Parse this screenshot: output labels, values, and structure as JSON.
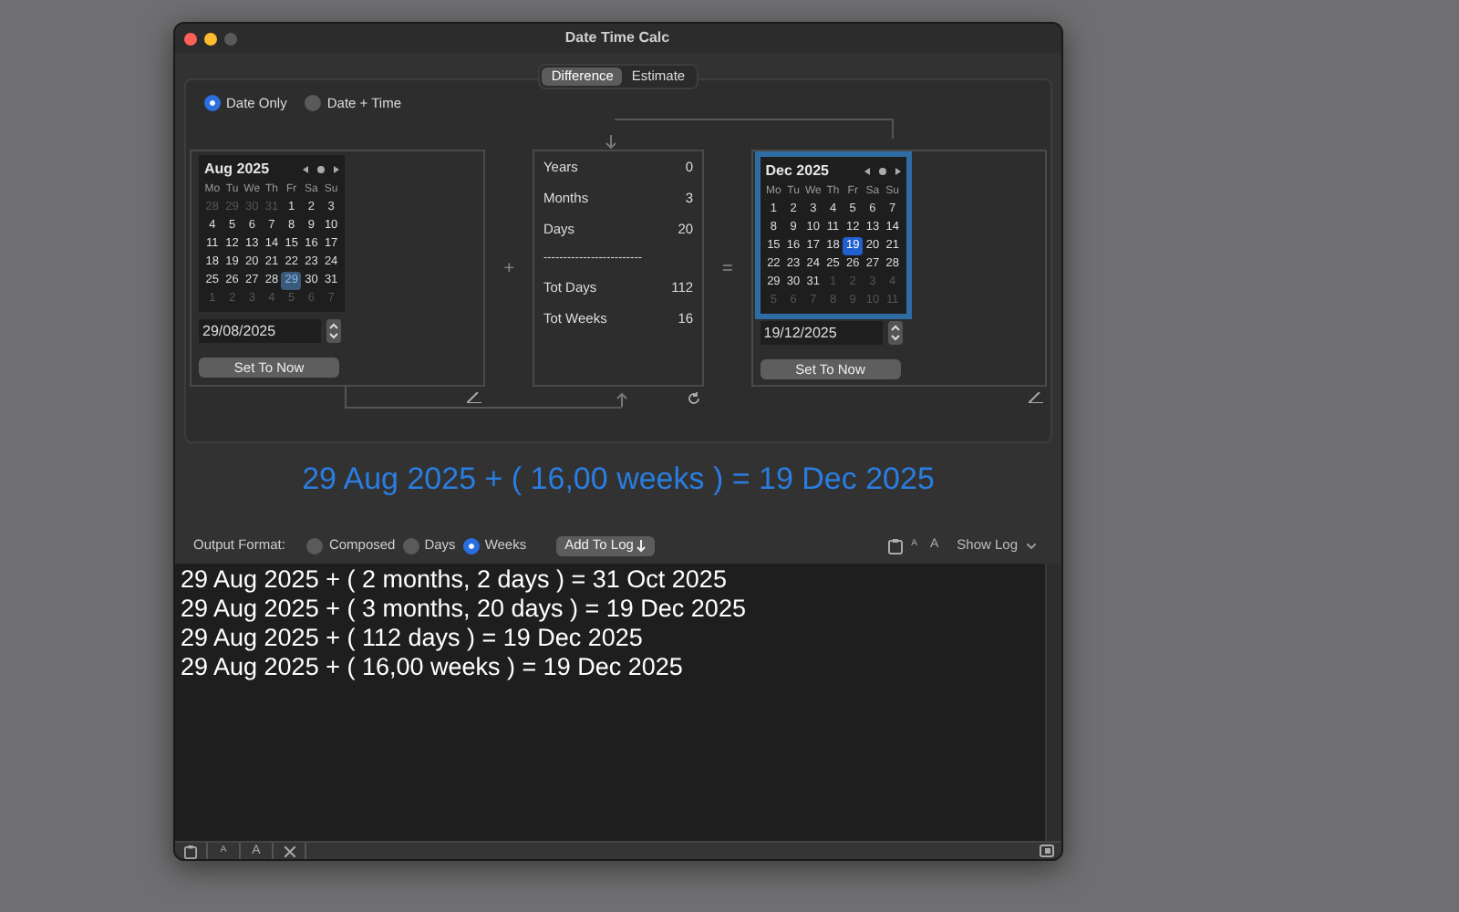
{
  "window": {
    "title": "Date Time Calc"
  },
  "tabs": [
    {
      "label": "Difference",
      "selected": true
    },
    {
      "label": "Estimate",
      "selected": false
    }
  ],
  "mode": [
    {
      "label": "Date Only",
      "selected": true
    },
    {
      "label": "Date + Time",
      "selected": false
    }
  ],
  "start": {
    "month": "Aug 2025",
    "weekdays": [
      "Mo",
      "Tu",
      "We",
      "Th",
      "Fr",
      "Sa",
      "Su"
    ],
    "focused": false,
    "weeks": [
      [
        {
          "d": "28",
          "muted": true,
          "selected": false
        },
        {
          "d": "29",
          "muted": true,
          "selected": false
        },
        {
          "d": "30",
          "muted": true,
          "selected": false
        },
        {
          "d": "31",
          "muted": true,
          "selected": false
        },
        {
          "d": "1",
          "muted": false,
          "selected": false
        },
        {
          "d": "2",
          "muted": false,
          "selected": false
        },
        {
          "d": "3",
          "muted": false,
          "selected": false
        }
      ],
      [
        {
          "d": "4",
          "muted": false,
          "selected": false
        },
        {
          "d": "5",
          "muted": false,
          "selected": false
        },
        {
          "d": "6",
          "muted": false,
          "selected": false
        },
        {
          "d": "7",
          "muted": false,
          "selected": false
        },
        {
          "d": "8",
          "muted": false,
          "selected": false
        },
        {
          "d": "9",
          "muted": false,
          "selected": false
        },
        {
          "d": "10",
          "muted": false,
          "selected": false
        }
      ],
      [
        {
          "d": "11",
          "muted": false,
          "selected": false
        },
        {
          "d": "12",
          "muted": false,
          "selected": false
        },
        {
          "d": "13",
          "muted": false,
          "selected": false
        },
        {
          "d": "14",
          "muted": false,
          "selected": false
        },
        {
          "d": "15",
          "muted": false,
          "selected": false
        },
        {
          "d": "16",
          "muted": false,
          "selected": false
        },
        {
          "d": "17",
          "muted": false,
          "selected": false
        }
      ],
      [
        {
          "d": "18",
          "muted": false,
          "selected": false
        },
        {
          "d": "19",
          "muted": false,
          "selected": false
        },
        {
          "d": "20",
          "muted": false,
          "selected": false
        },
        {
          "d": "21",
          "muted": false,
          "selected": false
        },
        {
          "d": "22",
          "muted": false,
          "selected": false
        },
        {
          "d": "23",
          "muted": false,
          "selected": false
        },
        {
          "d": "24",
          "muted": false,
          "selected": false
        }
      ],
      [
        {
          "d": "25",
          "muted": false,
          "selected": false
        },
        {
          "d": "26",
          "muted": false,
          "selected": false
        },
        {
          "d": "27",
          "muted": false,
          "selected": false
        },
        {
          "d": "28",
          "muted": false,
          "selected": false
        },
        {
          "d": "29",
          "muted": false,
          "selected": true
        },
        {
          "d": "30",
          "muted": false,
          "selected": false
        },
        {
          "d": "31",
          "muted": false,
          "selected": false
        }
      ],
      [
        {
          "d": "1",
          "muted": true,
          "selected": false
        },
        {
          "d": "2",
          "muted": true,
          "selected": false
        },
        {
          "d": "3",
          "muted": true,
          "selected": false
        },
        {
          "d": "4",
          "muted": true,
          "selected": false
        },
        {
          "d": "5",
          "muted": true,
          "selected": false
        },
        {
          "d": "6",
          "muted": true,
          "selected": false
        },
        {
          "d": "7",
          "muted": true,
          "selected": false
        }
      ]
    ],
    "date": "29/08/2025",
    "button": "Set To Now"
  },
  "operator_plus": "+",
  "difference": {
    "rows": [
      {
        "label": "Years",
        "value": "0"
      },
      {
        "label": "Months",
        "value": "3"
      },
      {
        "label": "Days",
        "value": "20"
      }
    ],
    "separator": "-------------------------",
    "totals": [
      {
        "label": "Tot Days",
        "value": "112"
      },
      {
        "label": "Tot Weeks",
        "value": "16"
      }
    ]
  },
  "operator_equals": "=",
  "end": {
    "month": "Dec 2025",
    "weekdays": [
      "Mo",
      "Tu",
      "We",
      "Th",
      "Fr",
      "Sa",
      "Su"
    ],
    "focused": true,
    "weeks": [
      [
        {
          "d": "1",
          "muted": false,
          "selected": false
        },
        {
          "d": "2",
          "muted": false,
          "selected": false
        },
        {
          "d": "3",
          "muted": false,
          "selected": false
        },
        {
          "d": "4",
          "muted": false,
          "selected": false
        },
        {
          "d": "5",
          "muted": false,
          "selected": false
        },
        {
          "d": "6",
          "muted": false,
          "selected": false
        },
        {
          "d": "7",
          "muted": false,
          "selected": false
        }
      ],
      [
        {
          "d": "8",
          "muted": false,
          "selected": false
        },
        {
          "d": "9",
          "muted": false,
          "selected": false
        },
        {
          "d": "10",
          "muted": false,
          "selected": false
        },
        {
          "d": "11",
          "muted": false,
          "selected": false
        },
        {
          "d": "12",
          "muted": false,
          "selected": false
        },
        {
          "d": "13",
          "muted": false,
          "selected": false
        },
        {
          "d": "14",
          "muted": false,
          "selected": false
        }
      ],
      [
        {
          "d": "15",
          "muted": false,
          "selected": false
        },
        {
          "d": "16",
          "muted": false,
          "selected": false
        },
        {
          "d": "17",
          "muted": false,
          "selected": false
        },
        {
          "d": "18",
          "muted": false,
          "selected": false
        },
        {
          "d": "19",
          "muted": false,
          "selected": true
        },
        {
          "d": "20",
          "muted": false,
          "selected": false
        },
        {
          "d": "21",
          "muted": false,
          "selected": false
        }
      ],
      [
        {
          "d": "22",
          "muted": false,
          "selected": false
        },
        {
          "d": "23",
          "muted": false,
          "selected": false
        },
        {
          "d": "24",
          "muted": false,
          "selected": false
        },
        {
          "d": "25",
          "muted": false,
          "selected": false
        },
        {
          "d": "26",
          "muted": false,
          "selected": false
        },
        {
          "d": "27",
          "muted": false,
          "selected": false
        },
        {
          "d": "28",
          "muted": false,
          "selected": false
        }
      ],
      [
        {
          "d": "29",
          "muted": false,
          "selected": false
        },
        {
          "d": "30",
          "muted": false,
          "selected": false
        },
        {
          "d": "31",
          "muted": false,
          "selected": false
        },
        {
          "d": "1",
          "muted": true,
          "selected": false
        },
        {
          "d": "2",
          "muted": true,
          "selected": false
        },
        {
          "d": "3",
          "muted": true,
          "selected": false
        },
        {
          "d": "4",
          "muted": true,
          "selected": false
        }
      ],
      [
        {
          "d": "5",
          "muted": true,
          "selected": false
        },
        {
          "d": "6",
          "muted": true,
          "selected": false
        },
        {
          "d": "7",
          "muted": true,
          "selected": false
        },
        {
          "d": "8",
          "muted": true,
          "selected": false
        },
        {
          "d": "9",
          "muted": true,
          "selected": false
        },
        {
          "d": "10",
          "muted": true,
          "selected": false
        },
        {
          "d": "11",
          "muted": true,
          "selected": false
        }
      ]
    ],
    "date": "19/12/2025",
    "button": "Set To Now"
  },
  "result": "29 Aug 2025 + ( 16,00 weeks ) = 19 Dec 2025",
  "output": {
    "label": "Output Format:",
    "formats": [
      {
        "label": "Composed",
        "selected": false
      },
      {
        "label": "Days",
        "selected": false
      },
      {
        "label": "Weeks",
        "selected": true
      }
    ],
    "add_button": "Add To Log",
    "small_font": "A",
    "large_font": "A",
    "show_log": "Show Log"
  },
  "log": [
    "29 Aug 2025 + ( 2 months, 2 days ) = 31 Oct 2025",
    "29 Aug 2025 + ( 3 months, 20 days ) = 19 Dec 2025",
    "29 Aug 2025 + ( 112 days ) = 19 Dec 2025",
    "29 Aug 2025 + ( 16,00 weeks ) = 19 Dec 2025"
  ],
  "bottom_bar": {
    "small_font": "A",
    "large_font": "A"
  }
}
